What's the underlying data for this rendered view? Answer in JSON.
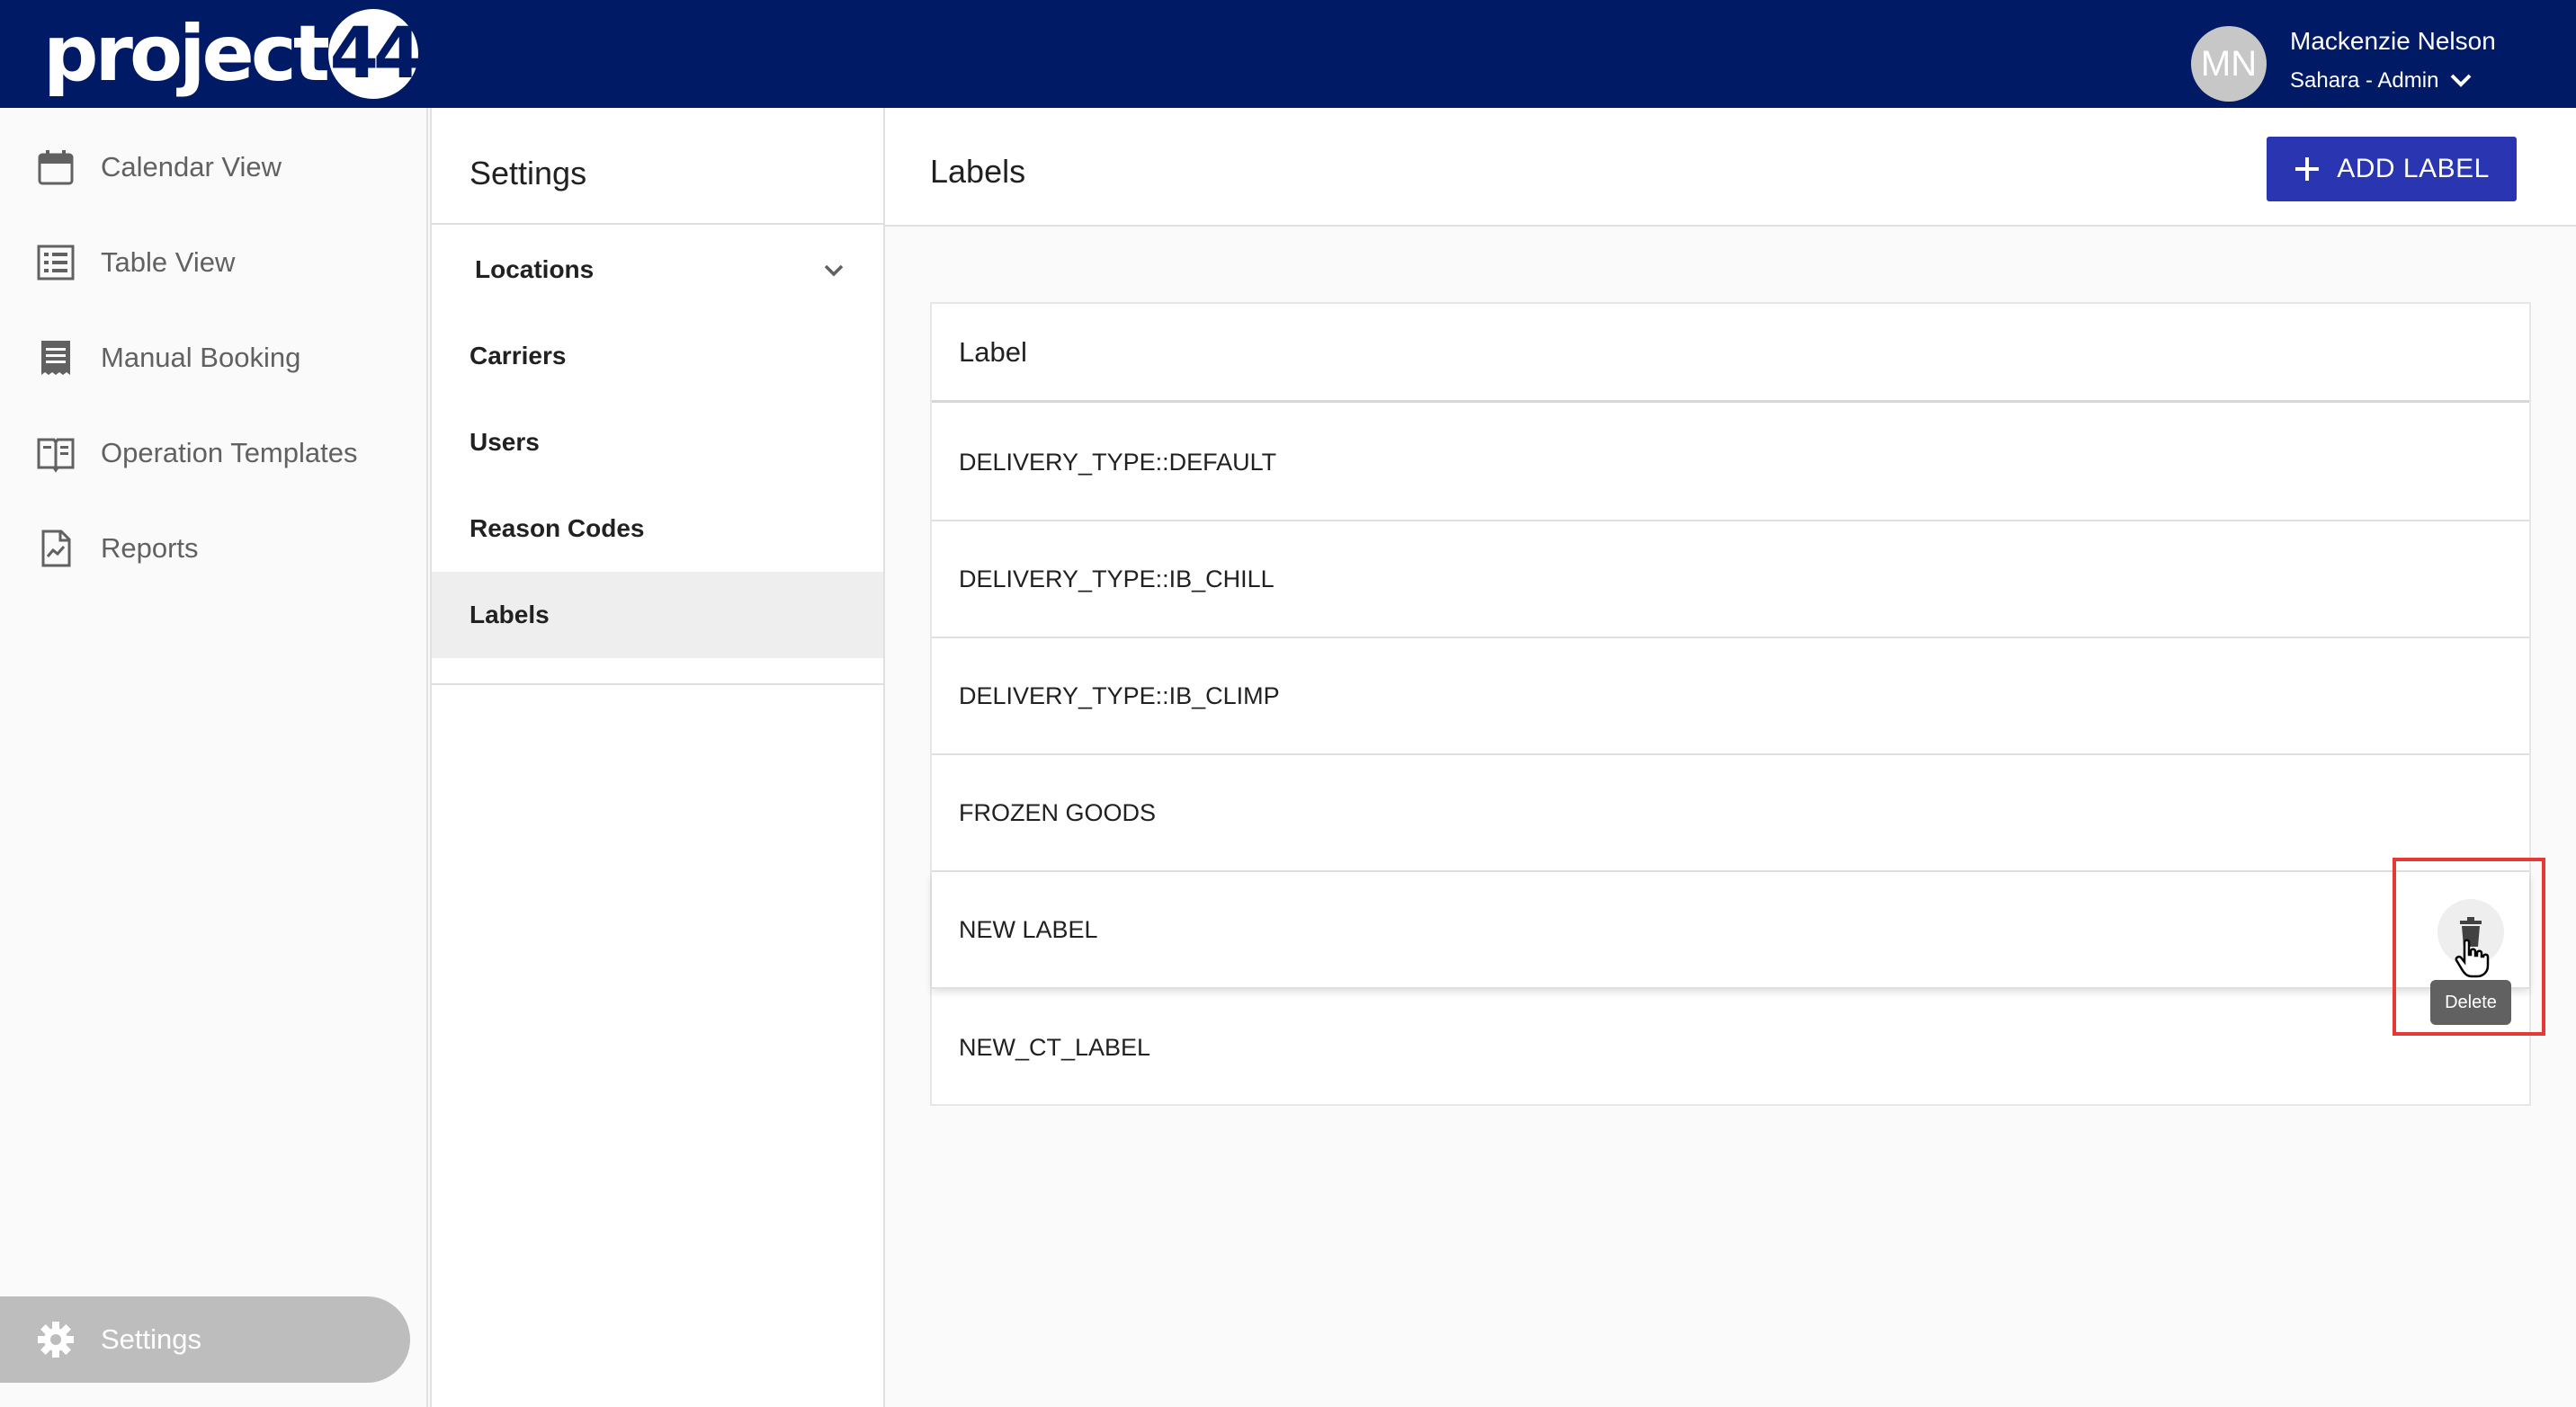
{
  "brand": {
    "logo_text": "project",
    "logo_badge": "44"
  },
  "user": {
    "initials": "MN",
    "name": "Mackenzie Nelson",
    "org": "Sahara - Admin"
  },
  "nav": {
    "items": [
      {
        "label": "Calendar View",
        "icon": "calendar-icon"
      },
      {
        "label": "Table View",
        "icon": "list-icon"
      },
      {
        "label": "Manual Booking",
        "icon": "receipt-icon"
      },
      {
        "label": "Operation Templates",
        "icon": "book-icon"
      },
      {
        "label": "Reports",
        "icon": "report-icon"
      }
    ],
    "settings_label": "Settings"
  },
  "settings": {
    "title": "Settings",
    "items": [
      {
        "label": "Locations"
      },
      {
        "label": "Carriers"
      },
      {
        "label": "Users"
      },
      {
        "label": "Reason Codes"
      },
      {
        "label": "Labels"
      }
    ]
  },
  "main": {
    "title": "Labels",
    "add_button": "ADD LABEL",
    "table": {
      "header": "Label",
      "rows": [
        "DELIVERY_TYPE::DEFAULT",
        "DELIVERY_TYPE::IB_CHILL",
        "DELIVERY_TYPE::IB_CLIMP",
        "FROZEN GOODS",
        "NEW LABEL",
        "NEW_CT_LABEL"
      ]
    },
    "delete_tooltip": "Delete"
  },
  "colors": {
    "topbar": "#001a66",
    "accent": "#2a36b1",
    "highlight": "#e53935"
  }
}
